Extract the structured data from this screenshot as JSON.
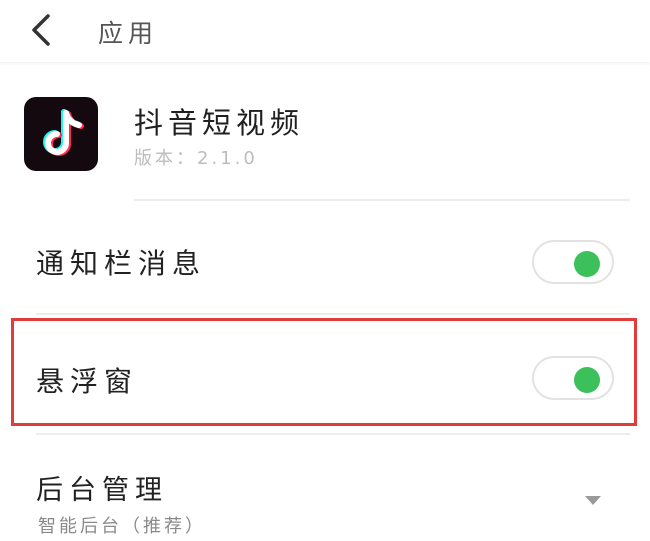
{
  "header": {
    "title": "应用"
  },
  "app": {
    "name": "抖音短视频",
    "version": "版本：2.1.0",
    "icon": "tiktok-note-icon"
  },
  "settings": {
    "notification": {
      "label": "通知栏消息",
      "enabled": true
    },
    "floating_window": {
      "label": "悬浮窗",
      "enabled": true,
      "highlighted": true
    },
    "background": {
      "label": "后台管理",
      "value": "智能后台（推荐）"
    }
  },
  "colors": {
    "toggle_on": "#3cc05a",
    "highlight": "#e23b3b",
    "tiktok_cyan": "#25f4ee",
    "tiktok_red": "#fe2c55"
  }
}
